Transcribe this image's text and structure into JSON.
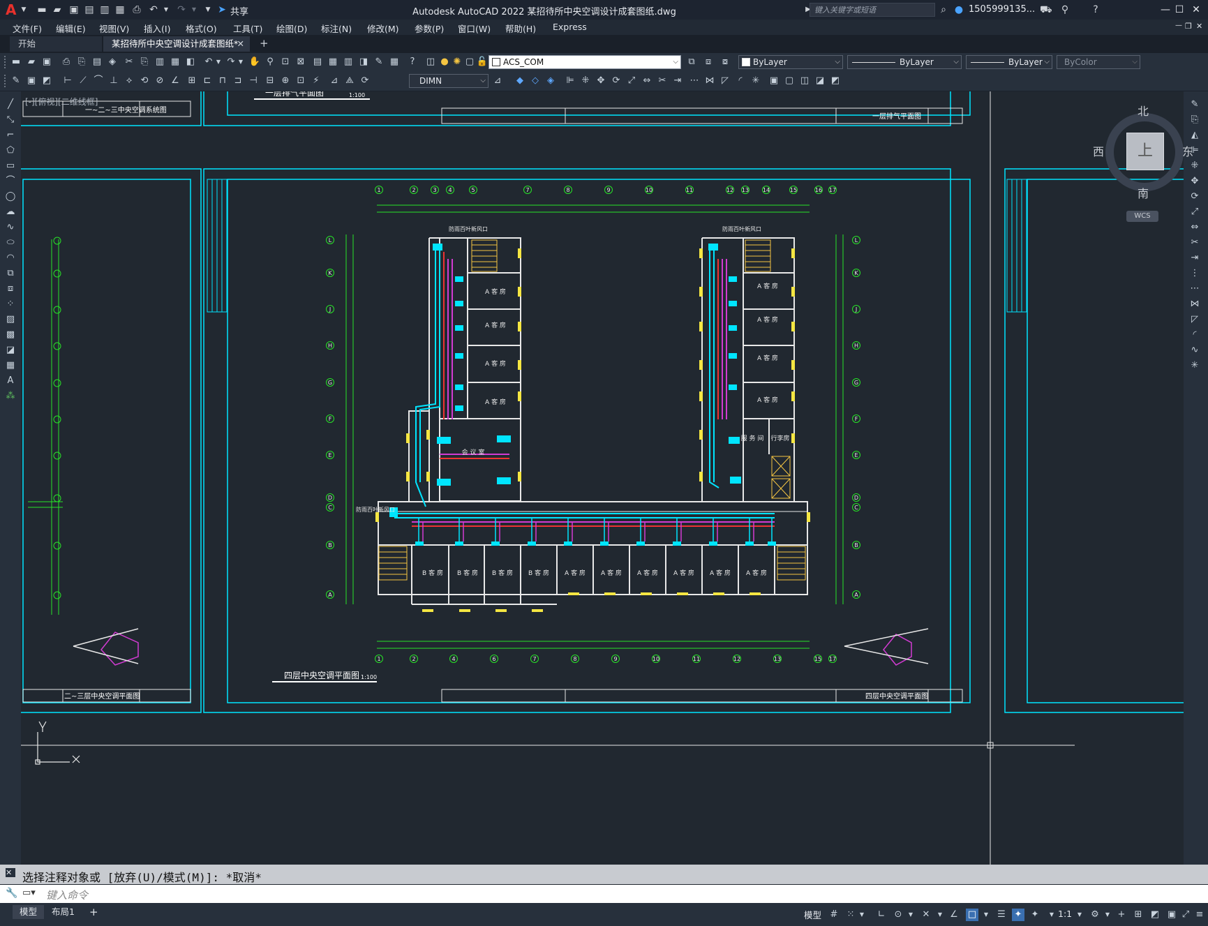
{
  "app": {
    "title": "Autodesk AutoCAD 2022    某招待所中央空调设计成套图纸.dwg",
    "logo": "A",
    "share_label": "共享",
    "search_placeholder": "键入关键字或短语",
    "user": "1505999135..."
  },
  "menu": [
    "文件(F)",
    "编辑(E)",
    "视图(V)",
    "插入(I)",
    "格式(O)",
    "工具(T)",
    "绘图(D)",
    "标注(N)",
    "修改(M)",
    "参数(P)",
    "窗口(W)",
    "帮助(H)",
    "Express"
  ],
  "tabs": {
    "start": "开始",
    "drawing": "某招待所中央空调设计成套图纸*",
    "add": "+"
  },
  "toolbar": {
    "layer": "ACS_COM",
    "color": "ByLayer",
    "linetype": "ByLayer",
    "lineweight": "ByLayer",
    "plotstyle": "ByColor",
    "dimstyle": "DIMN"
  },
  "viewport_label": "[-][俯视][二维线框]",
  "viewcube": {
    "north": "北",
    "south": "南",
    "east": "东",
    "west": "西",
    "top": "上",
    "wcs": "WCS"
  },
  "drawing": {
    "top_left_title": "一~二~三中央空调系统图",
    "top_center_title": "一层排气平面图",
    "top_center_scale": "1:100",
    "top_right_title": "一层排气平面图",
    "left_bottom_title": "二~三层中央空调平面图",
    "main_title": "四层中央空调平面图",
    "main_scale": "1:100",
    "main_sheet_title": "四层中央空调平面图",
    "room_a": "A 客 房",
    "room_b": "B 客 房",
    "meeting_room": "会 议 室",
    "service_room": "服 务 间",
    "luggage_room": "行李房",
    "vent_label": "防雨百叶新风口",
    "col_top": [
      "1",
      "2",
      "3",
      "4",
      "5",
      "7",
      "8",
      "9",
      "10",
      "11",
      "12",
      "13",
      "14",
      "15",
      "16",
      "17"
    ],
    "col_bottom": [
      "1",
      "2",
      "4",
      "6",
      "7",
      "8",
      "9",
      "10",
      "11",
      "12",
      "13",
      "15",
      "17"
    ],
    "rows": [
      "L",
      "K",
      "J",
      "H",
      "G",
      "F",
      "E",
      "D",
      "C",
      "B",
      "A"
    ]
  },
  "command": {
    "history": "选择注释对象或 [放弃(U)/模式(M)]: *取消*",
    "placeholder": "键入命令"
  },
  "status": {
    "model_tab": "模型",
    "layout_tab": "布局1",
    "model_label": "模型",
    "scale": "1:1"
  }
}
